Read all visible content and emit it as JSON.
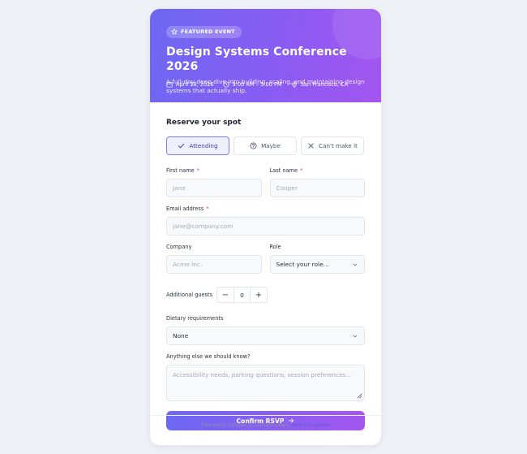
{
  "hero": {
    "badge": "FEATURED EVENT",
    "title": "Design Systems Conference 2026",
    "description": "A full-day deep dive into building, scaling, and maintaining design systems that actually ship.",
    "date": "April 18, 2026",
    "time": "9:00 AM – 5:00 PM",
    "location": "San Francisco, CA"
  },
  "form": {
    "section_title": "Reserve your spot",
    "rsvp_options": [
      {
        "label": "Attending",
        "icon": "check-icon",
        "selected": true
      },
      {
        "label": "Maybe",
        "icon": "question-circle-icon",
        "selected": false
      },
      {
        "label": "Can't make it",
        "icon": "x-icon",
        "selected": false
      }
    ],
    "first_name": {
      "label": "First name",
      "placeholder": "Jane"
    },
    "last_name": {
      "label": "Last name",
      "placeholder": "Cooper"
    },
    "email": {
      "label": "Email address",
      "placeholder": "jane@company.com"
    },
    "company": {
      "label": "Company",
      "placeholder": "Acme Inc."
    },
    "role": {
      "label": "Role",
      "value": "Select your role..."
    },
    "guests": {
      "label": "Additional guests",
      "value": "0",
      "decrement": "−",
      "increment": "+"
    },
    "dietary": {
      "label": "Dietary requirements",
      "value": "None"
    },
    "notes": {
      "label": "Anything else we should know?",
      "placeholder": "Accessibility needs, parking questions, session preferences..."
    },
    "required_mark": "*",
    "submit_label": "Confirm RSVP"
  },
  "footer": {
    "text": "Free event. Limited to 200 attendees.",
    "link": "View full agenda"
  },
  "colors": {
    "accent_start": "#6d68f2",
    "accent_end": "#a356ef",
    "required": "#e23b4c"
  }
}
